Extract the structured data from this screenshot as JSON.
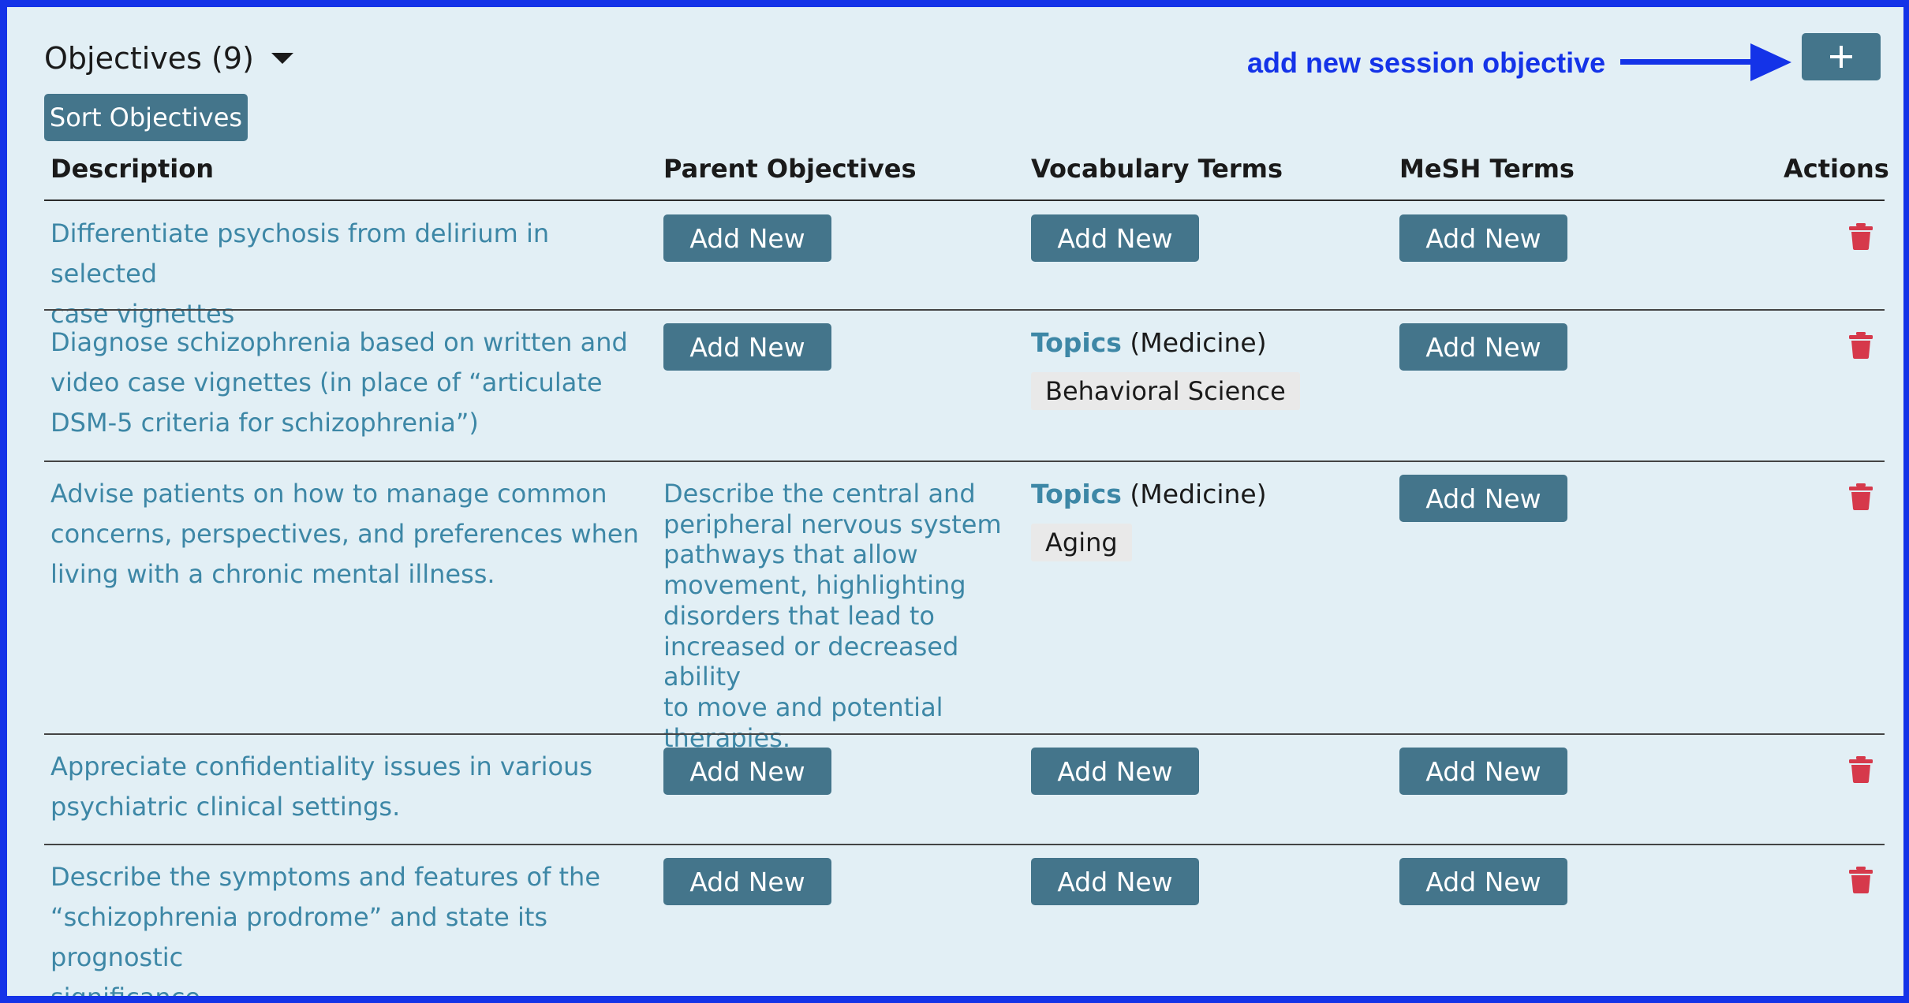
{
  "header": {
    "title": "Objectives (9)"
  },
  "annotation": {
    "text": "add new session objective"
  },
  "toolbar": {
    "add_label": "+",
    "sort_label": "Sort Objectives"
  },
  "table": {
    "columns": [
      "Description",
      "Parent Objectives",
      "Vocabulary Terms",
      "MeSH Terms",
      "Actions"
    ],
    "add_new_label": "Add New",
    "rows": [
      {
        "description": [
          "Differentiate psychosis from delirium in selected",
          "case vignettes"
        ],
        "parent": null,
        "vocabulary": null,
        "mesh": null
      },
      {
        "description": [
          "Diagnose schizophrenia based on written and",
          "video case vignettes (in place of “articulate",
          "DSM-5 criteria for schizophrenia”)"
        ],
        "parent": null,
        "vocabulary": {
          "vocab": "Topics",
          "school": "(Medicine)",
          "term": "Behavioral Science"
        },
        "mesh": null
      },
      {
        "description": [
          "Advise patients on how to manage common",
          "concerns, perspectives, and preferences when",
          "living with a chronic mental illness."
        ],
        "parent": [
          "Describe the central and",
          "peripheral nervous system",
          "pathways that allow",
          "movement, highlighting",
          "disorders that lead to",
          "increased or decreased ability",
          "to move and potential",
          "therapies."
        ],
        "vocabulary": {
          "vocab": "Topics",
          "school": "(Medicine)",
          "term": "Aging"
        },
        "mesh": null
      },
      {
        "description": [
          "Appreciate confidentiality issues in various",
          "psychiatric clinical settings."
        ],
        "parent": null,
        "vocabulary": null,
        "mesh": null
      },
      {
        "description": [
          "Describe the symptoms and features of the",
          "“schizophrenia prodrome” and state its prognostic",
          "significance."
        ],
        "parent": null,
        "vocabulary": null,
        "mesh": null
      }
    ]
  },
  "colors": {
    "frame_border": "#1433e8",
    "background": "#e2eff5",
    "button": "#44758b",
    "link": "#3d87a6",
    "trash": "#d6394b"
  },
  "icons": {
    "expand": "caret-down-icon",
    "delete": "trash-icon",
    "add": "plus-icon"
  }
}
